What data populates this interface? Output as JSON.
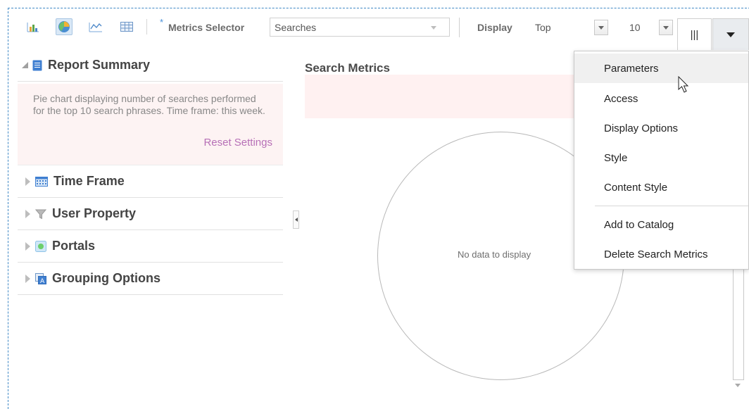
{
  "toolbar": {
    "required_marker": "*",
    "metrics_selector_label": "Metrics Selector",
    "metrics_selector_value": "Searches",
    "display_label": "Display",
    "display_value": "Top",
    "count_value": "10",
    "columns_icon_glyph": "|||"
  },
  "icons": {
    "bar_chart": "bar-chart-icon",
    "pie_chart": "pie-chart-icon",
    "line_chart": "line-chart-icon",
    "table": "table-icon",
    "columns": "columns-icon",
    "menu": "caret-down-icon"
  },
  "left_panel": {
    "report_summary": {
      "title": "Report Summary",
      "text": "Pie chart displaying number of searches performed for the top 10 search phrases. Time frame: this week.",
      "reset_label": "Reset Settings"
    },
    "sections": [
      {
        "title": "Time Frame",
        "icon": "calendar-icon"
      },
      {
        "title": "User Property",
        "icon": "filter-icon"
      },
      {
        "title": "Portals",
        "icon": "portal-icon"
      },
      {
        "title": "Grouping Options",
        "icon": "grouping-icon"
      }
    ]
  },
  "chart": {
    "title": "Search Metrics",
    "empty_message": "No data to display"
  },
  "menu": {
    "items": [
      {
        "label": "Parameters",
        "hover": true
      },
      {
        "label": "Access"
      },
      {
        "label": "Display Options"
      },
      {
        "label": "Style"
      },
      {
        "label": "Content Style"
      },
      {
        "label": "Add to Catalog"
      },
      {
        "label": "Delete Search Metrics"
      }
    ]
  },
  "colors": {
    "accent": "#3f88c5",
    "summary_bg": "#fdf3f3",
    "link": "#b770b7"
  }
}
